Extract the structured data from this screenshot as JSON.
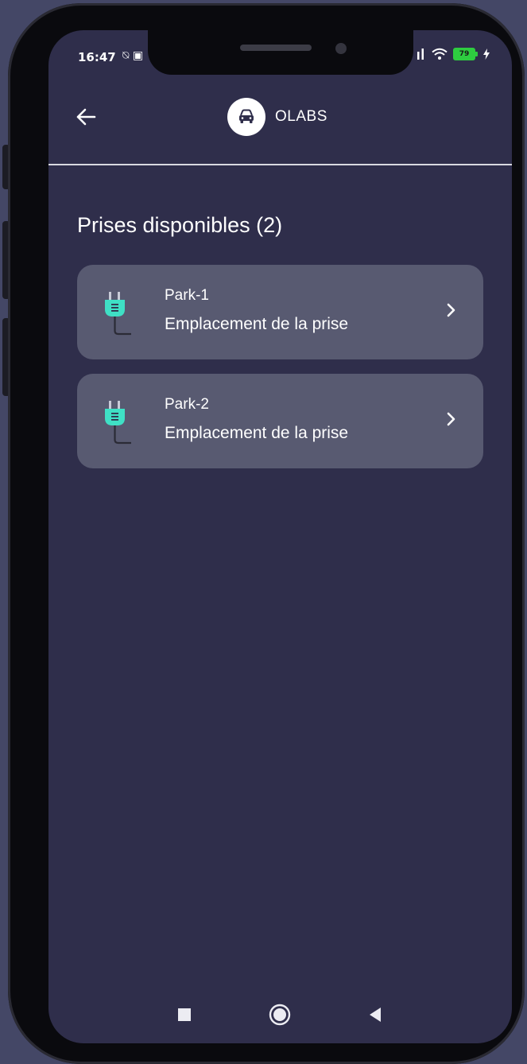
{
  "status_bar": {
    "time": "16:47",
    "left_icons": "⍉ ▣",
    "battery_level": "79"
  },
  "header": {
    "back_icon": "arrow-left-icon",
    "brand_name": "OLABS",
    "brand_icon": "car-icon"
  },
  "main": {
    "section_title": "Prises disponibles (2)",
    "items": [
      {
        "title": "Park-1",
        "subtitle": "Emplacement de la prise",
        "icon": "plug-icon"
      },
      {
        "title": "Park-2",
        "subtitle": "Emplacement de la prise",
        "icon": "plug-icon"
      }
    ]
  },
  "nav_bar": {
    "buttons": [
      "recent-apps",
      "home",
      "back"
    ]
  },
  "colors": {
    "background": "#444766",
    "screen": "#2f2e4b",
    "card": "#585a71",
    "plug_accent": "#3fe0c5",
    "battery": "#2ecc40"
  }
}
